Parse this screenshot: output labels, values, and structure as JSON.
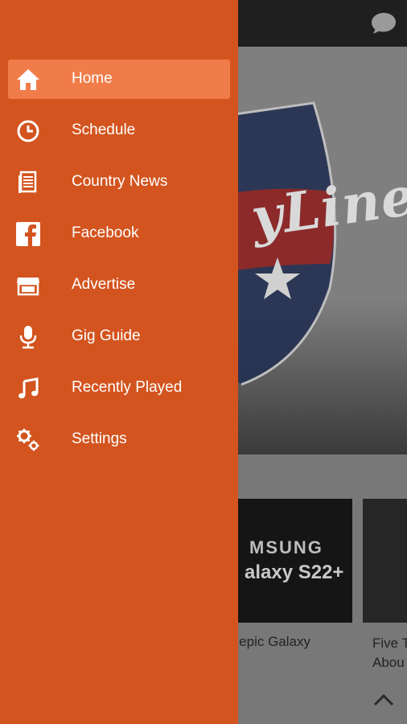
{
  "app_background": {
    "colors": {
      "topbar": "#1f1f1f",
      "overlay_gray": "#7b7b7b"
    },
    "topbar": {
      "icon": "chat-bubble-icon"
    },
    "hero": {
      "text": "yLine"
    },
    "news": {
      "cards": [
        {
          "brand_text": "MSUNG",
          "model_text": "alaxy S22+",
          "caption": "n epic Galaxy"
        },
        {
          "caption": "Five T\nAbou"
        }
      ],
      "scroll_icon": "chevron-up-icon"
    }
  },
  "drawer": {
    "colors": {
      "background": "#d3541f",
      "active_item": "#f07c4a",
      "text": "#ffffff"
    },
    "items": [
      {
        "label": "Home",
        "icon": "home-icon",
        "active": true
      },
      {
        "label": "Schedule",
        "icon": "clock-icon",
        "active": false
      },
      {
        "label": "Country News",
        "icon": "newspaper-icon",
        "active": false
      },
      {
        "label": "Facebook",
        "icon": "facebook-icon",
        "active": false
      },
      {
        "label": "Advertise",
        "icon": "storefront-icon",
        "active": false
      },
      {
        "label": "Gig Guide",
        "icon": "microphone-icon",
        "active": false
      },
      {
        "label": "Recently Played",
        "icon": "music-note-icon",
        "active": false
      },
      {
        "label": "Settings",
        "icon": "gears-icon",
        "active": false
      }
    ]
  }
}
